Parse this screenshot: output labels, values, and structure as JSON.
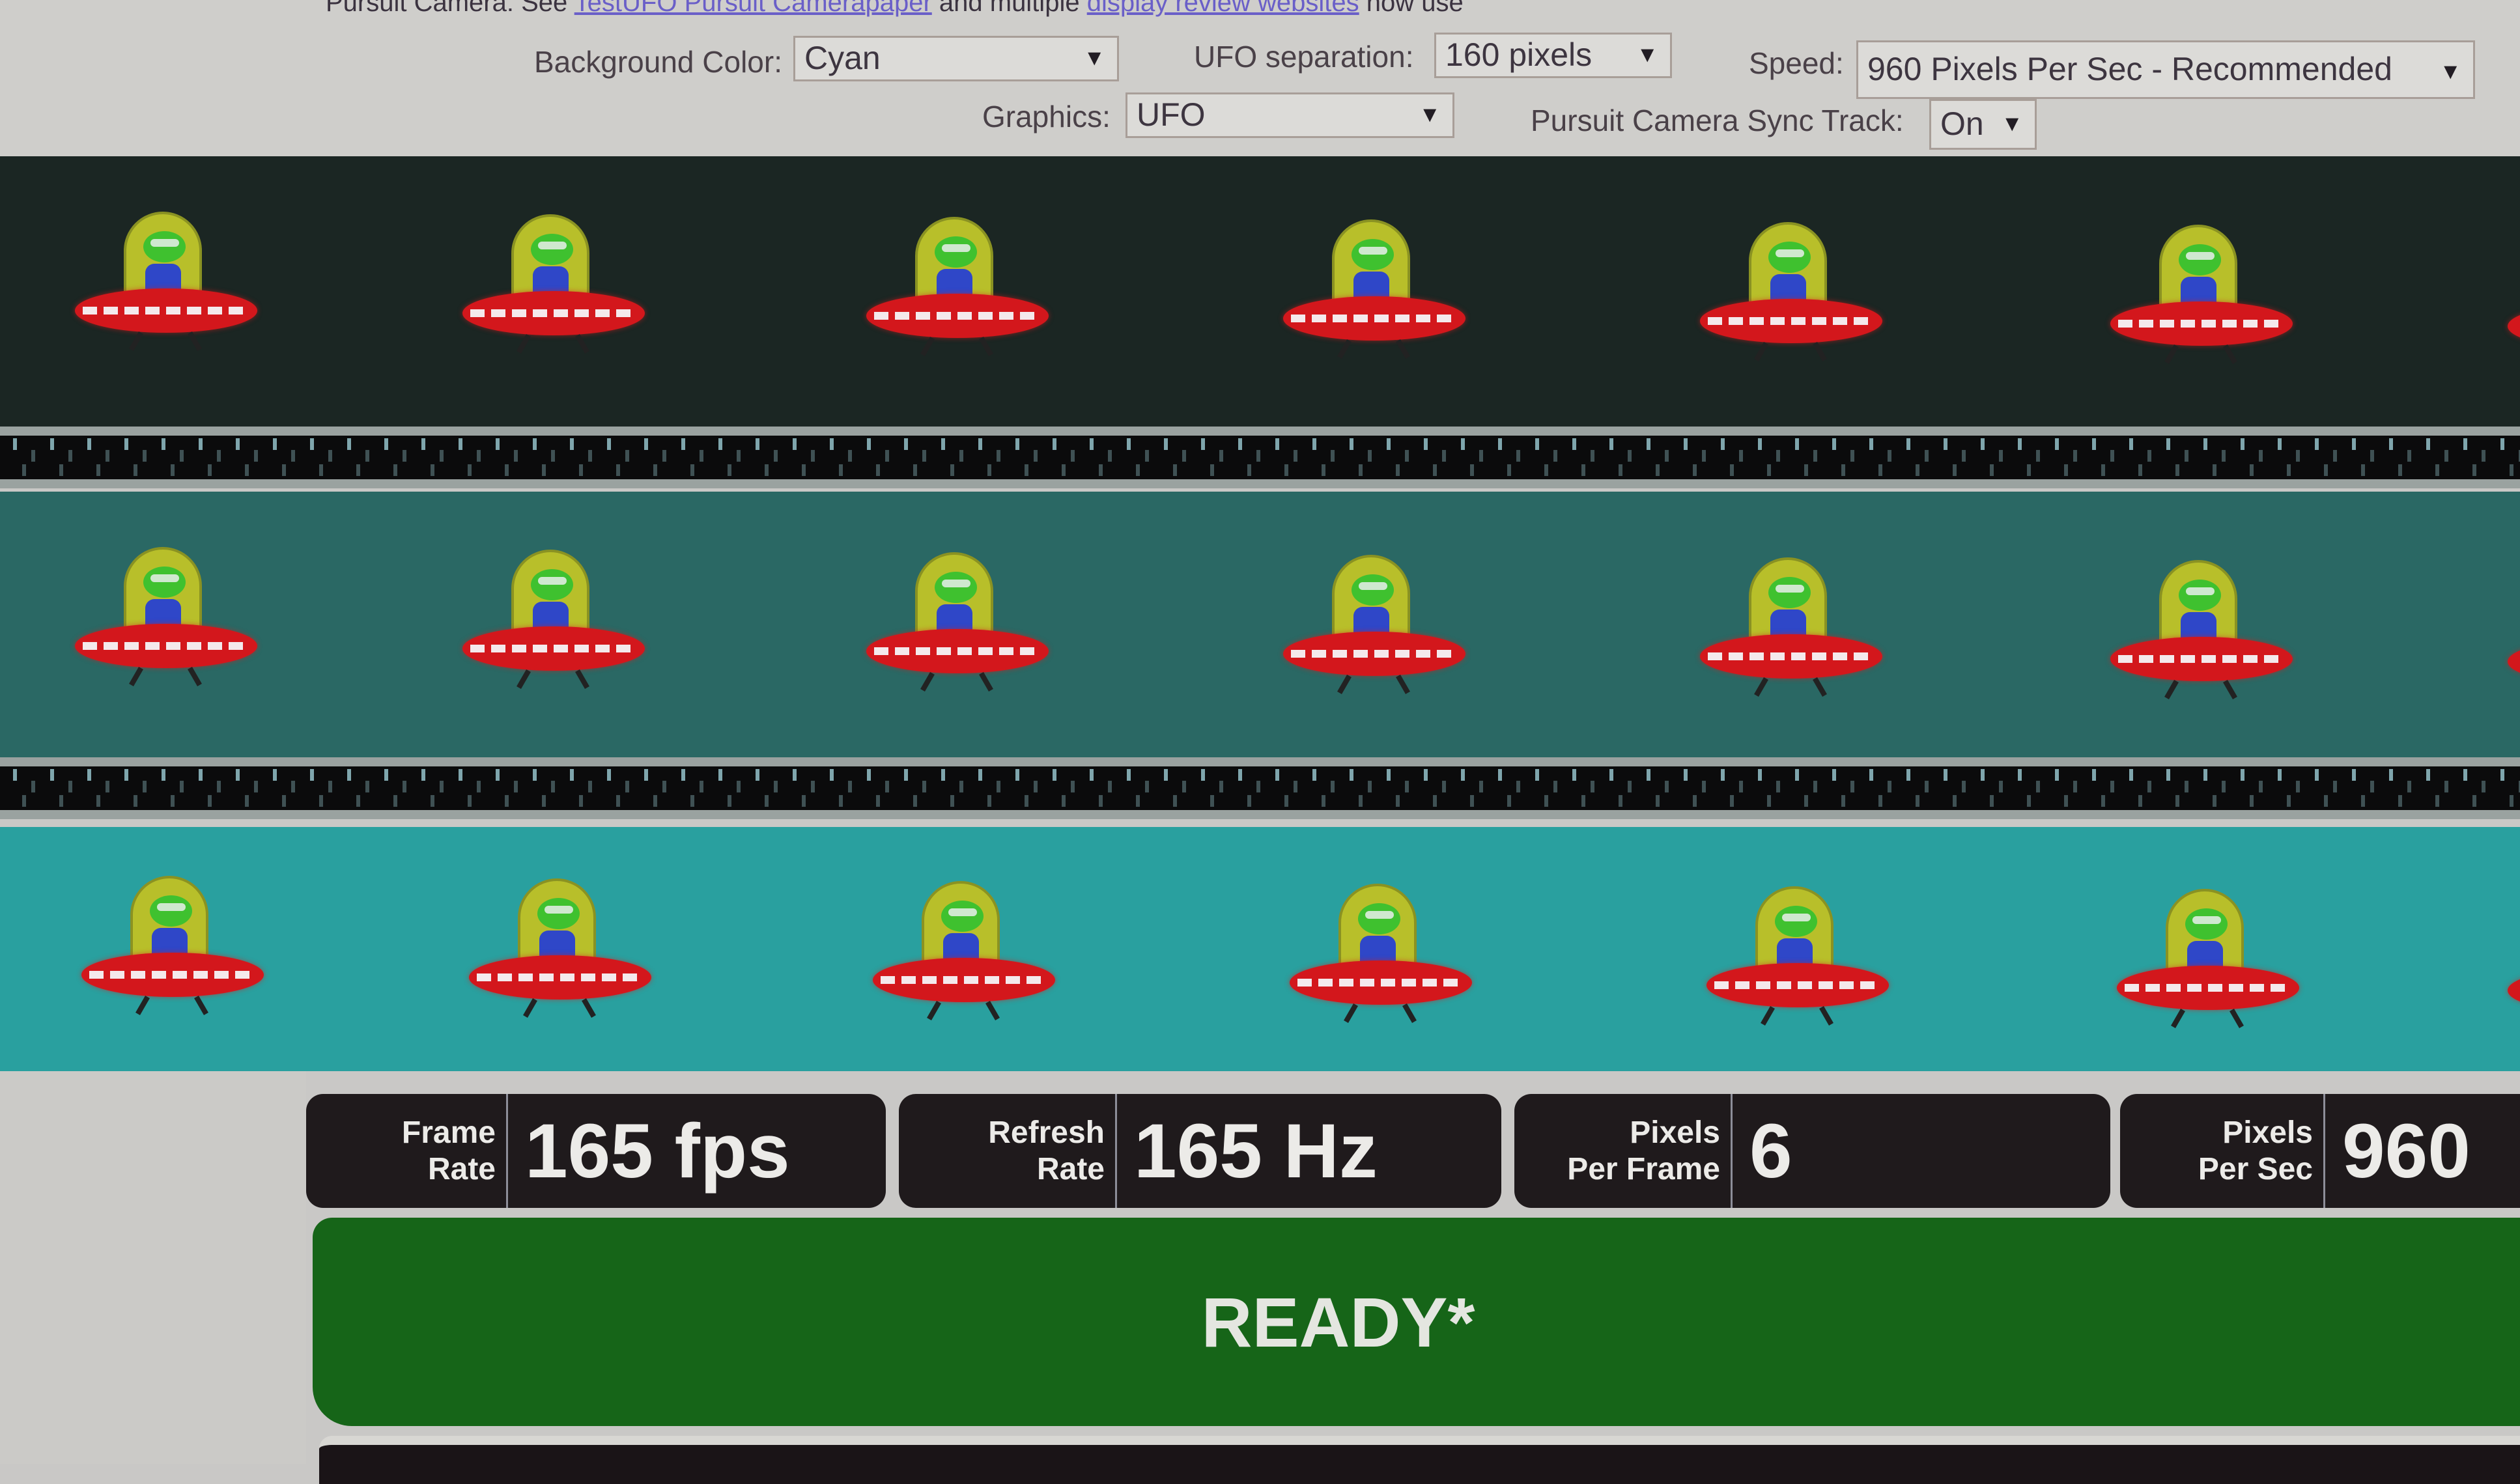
{
  "intro": {
    "prefix": "Pursuit Camera: See",
    "link1": "TestUFO Pursuit Camera",
    "link2": "paper",
    "middle": "and multiple",
    "link3": "display review websites",
    "suffix": "now use"
  },
  "controls": {
    "background_color": {
      "label": "Background Color:",
      "value": "Cyan"
    },
    "ufo_separation": {
      "label": "UFO separation:",
      "value": "160 pixels"
    },
    "speed": {
      "label": "Speed:",
      "value": "960 Pixels Per Sec - Recommended"
    },
    "graphics": {
      "label": "Graphics:",
      "value": "UFO"
    },
    "sync_track": {
      "label": "Pursuit Camera Sync Track:",
      "value": "On"
    },
    "arrow_glyph": "▼"
  },
  "lanes": [
    {
      "name": "dark",
      "color": "#1b2623",
      "ufo_count": 6
    },
    {
      "name": "medium",
      "color": "#2a6864",
      "ufo_count": 6
    },
    {
      "name": "cyan",
      "color": "#29a09f",
      "ufo_count": 6
    }
  ],
  "stats": [
    {
      "label_line1": "Frame",
      "label_line2": "Rate",
      "value": "165 fps"
    },
    {
      "label_line1": "Refresh",
      "label_line2": "Rate",
      "value": "165 Hz"
    },
    {
      "label_line1": "Pixels",
      "label_line2": "Per Frame",
      "value": "6"
    },
    {
      "label_line1": "Pixels",
      "label_line2": "Per Sec",
      "value": "960"
    }
  ],
  "status": {
    "text": "READY*",
    "color": "#166518"
  }
}
